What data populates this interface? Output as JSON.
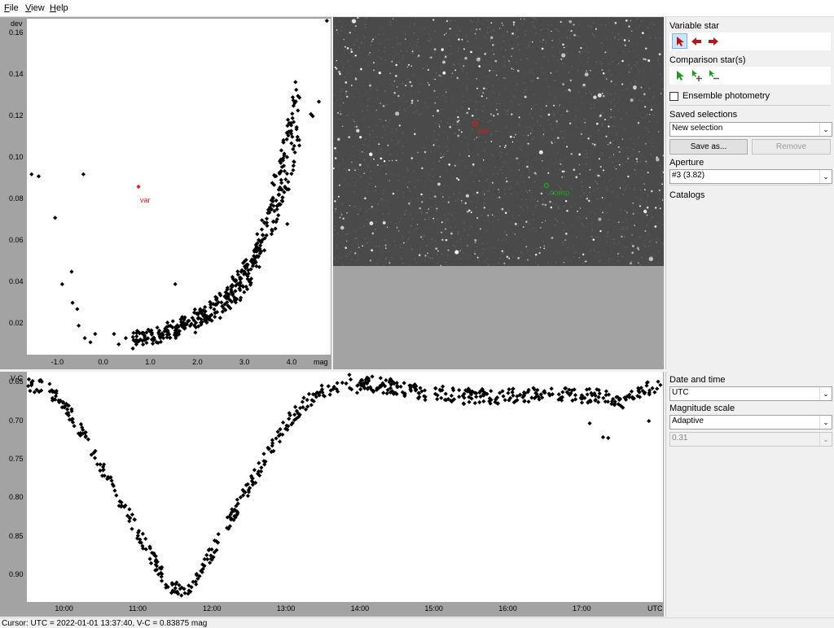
{
  "menu": {
    "file": "File",
    "view": "View",
    "help": "Help"
  },
  "chart_data": [
    {
      "type": "scatter",
      "ylabel": "dev",
      "xlabel": "mag",
      "xticks": [
        "-1.0",
        "0.0",
        "1.0",
        "2.0",
        "3.0",
        "4.0"
      ],
      "yticks": [
        "0.16",
        "0.14",
        "0.12",
        "0.10",
        "0.08",
        "0.06",
        "0.04",
        "0.02"
      ],
      "xlim": [
        -1.65,
        4.8
      ],
      "ylim": [
        0.005,
        0.167
      ],
      "highlight": {
        "label": "var",
        "x": 0.72,
        "y": 0.086,
        "color": "#d02020"
      },
      "points": [
        [
          -1.55,
          0.092
        ],
        [
          -1.4,
          0.091
        ],
        [
          -0.45,
          0.092
        ],
        [
          -1.05,
          0.071
        ],
        [
          -0.9,
          0.039
        ],
        [
          -0.7,
          0.045
        ],
        [
          -0.68,
          0.03
        ],
        [
          -0.58,
          0.027
        ],
        [
          -0.55,
          0.019
        ],
        [
          -0.42,
          0.013
        ],
        [
          -0.3,
          0.011
        ],
        [
          -0.2,
          0.015
        ],
        [
          0.2,
          0.015
        ],
        [
          0.3,
          0.01
        ],
        [
          0.45,
          0.013
        ],
        [
          0.6,
          0.008
        ],
        [
          1.5,
          0.039
        ],
        [
          4.72,
          0.166
        ],
        [
          4.55,
          0.127
        ],
        [
          4.38,
          0.121
        ],
        [
          4.42,
          0.12
        ],
        [
          3.7,
          0.082
        ],
        [
          3.88,
          0.068
        ]
      ]
    },
    {
      "type": "scatter",
      "ylabel": "V-C",
      "xlabel": "UTC",
      "xticks": [
        "10:00",
        "11:00",
        "12:00",
        "13:00",
        "14:00",
        "15:00",
        "16:00",
        "17:00"
      ],
      "yticks": [
        "0.65",
        "0.70",
        "0.75",
        "0.80",
        "0.85",
        "0.90"
      ],
      "ylim_inverted": [
        0.636,
        0.935
      ],
      "xlim_hours": [
        9.49,
        18.09
      ],
      "time_range": [
        "09:30",
        "18:05"
      ],
      "trend": [
        [
          9.5,
          0.65
        ],
        [
          9.8,
          0.66
        ],
        [
          10.15,
          0.7
        ],
        [
          10.5,
          0.76
        ],
        [
          10.85,
          0.82
        ],
        [
          11.2,
          0.88
        ],
        [
          11.45,
          0.92
        ],
        [
          11.7,
          0.915
        ],
        [
          12.0,
          0.87
        ],
        [
          12.4,
          0.8
        ],
        [
          12.8,
          0.735
        ],
        [
          13.1,
          0.69
        ],
        [
          13.4,
          0.665
        ],
        [
          13.7,
          0.655
        ],
        [
          14.2,
          0.652
        ],
        [
          14.8,
          0.662
        ],
        [
          15.4,
          0.668
        ],
        [
          16.0,
          0.668
        ],
        [
          16.6,
          0.665
        ],
        [
          17.2,
          0.668
        ],
        [
          17.5,
          0.675
        ],
        [
          17.85,
          0.66
        ],
        [
          18.05,
          0.655
        ]
      ],
      "outliers": [
        [
          17.1,
          0.703
        ],
        [
          17.28,
          0.721
        ],
        [
          17.35,
          0.722
        ],
        [
          17.9,
          0.7
        ],
        [
          13.85,
          0.64
        ]
      ]
    }
  ],
  "image_labels": {
    "var": "var",
    "comp": "comp"
  },
  "sidebar": {
    "variable_star": "Variable star",
    "comparison_stars": "Comparison star(s)",
    "ensemble": "Ensemble photometry",
    "saved_selections": "Saved selections",
    "saved_value": "New selection",
    "save_as": "Save as...",
    "remove": "Remove",
    "aperture": "Aperture",
    "aperture_value": "#3 (3.82)",
    "catalogs": "Catalogs",
    "date_time": "Date and time",
    "date_time_value": "UTC",
    "mag_scale": "Magnitude scale",
    "mag_scale_value": "Adaptive",
    "mag_range_value": "0.31"
  },
  "status": "Cursor: UTC = 2022-01-01 13:37:40, V-C = 0.83875 mag",
  "colors": {
    "var": "#d02020",
    "comp": "#20a020",
    "plot_bg": "#a3a3a3"
  }
}
